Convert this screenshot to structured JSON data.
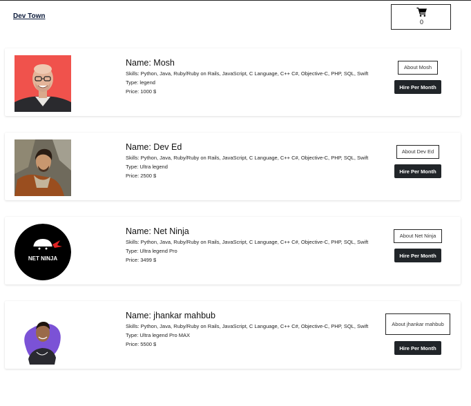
{
  "nav": {
    "brand": "Dev Town",
    "cart_count": "0"
  },
  "developers": [
    {
      "name": "Name: Mosh",
      "skills": "Skills: Python, Java, Ruby/Ruby on Rails, JavaScript, C Language, C++ C#, Objective-C, PHP, SQL, Swift",
      "type": "Type: legend",
      "price": "Price: 1000 $",
      "about_label": "About Mosh",
      "hire_label": "Hire Per Month"
    },
    {
      "name": "Name: Dev Ed",
      "skills": "Skills: Python, Java, Ruby/Ruby on Rails, JavaScript, C Language, C++ C#, Objective-C, PHP, SQL, Swift",
      "type": "Type: Ultra legend",
      "price": "Price: 2500 $",
      "about_label": "About Dev Ed",
      "hire_label": "Hire Per Month"
    },
    {
      "name": "Name: Net Ninja",
      "skills": "Skills: Python, Java, Ruby/Ruby on Rails, JavaScript, C Language, C++ C#, Objective-C, PHP, SQL, Swift",
      "type": "Type: Ultra legend Pro",
      "price": "Price: 3499 $",
      "about_label": "About Net Ninja",
      "hire_label": "Hire Per Month",
      "logo_text": "NET NINJA"
    },
    {
      "name": "Name: jhankar mahbub",
      "skills": "Skills: Python, Java, Ruby/Ruby on Rails, JavaScript, C Language, C++ C#, Objective-C, PHP, SQL, Swift",
      "type": "Type: Ultra legend Pro MAX",
      "price": "Price: 5500 $",
      "about_label": "About jhankar mahbub",
      "hire_label": "Hire Per Month"
    }
  ],
  "icons": {
    "cart": "shopping-cart-icon"
  },
  "colors": {
    "button_dark": "#212529",
    "brand_text": "#0b1a3a"
  }
}
